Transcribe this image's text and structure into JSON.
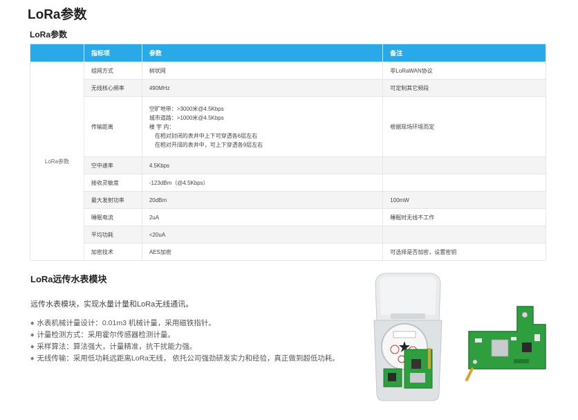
{
  "page_title": "LoRa参数",
  "section_title": "LoRa参数",
  "table": {
    "headers": [
      "",
      "指标项",
      "参数",
      "备注"
    ],
    "group_label": "LoRa参数",
    "rows": [
      {
        "item": "组网方式",
        "param": "树状网",
        "note": "非LoRaWAN协议"
      },
      {
        "item": "无线核心频率",
        "param": "490MHz",
        "note": "可定制其它频段"
      },
      {
        "item": "传输距离",
        "param_lines": [
          "空旷地带：>3000米@4.5Kbps",
          "城市道路：>1000米@4.5Kbps",
          "楼 宇 内：",
          "在相对封闭的表井中上下可穿透各6层左右",
          "在相对开阔的表井中，可上下穿透各9层左右"
        ],
        "note": "根据现场环境而定"
      },
      {
        "item": "空中速率",
        "param": "4.5Kbps",
        "note": ""
      },
      {
        "item": "接收灵敏度",
        "param": "-123dBm（@4.5Kbps）",
        "note": ""
      },
      {
        "item": "最大发射功率",
        "param": "20dBm",
        "note": "100mW"
      },
      {
        "item": "睡眠电流",
        "param": "2uA",
        "note": "睡眠时无线不工作"
      },
      {
        "item": "平均功耗",
        "param": "<20uA",
        "note": ""
      },
      {
        "item": "加密技术",
        "param": "AES加密",
        "note": "可选择是否加密，设置密钥"
      }
    ]
  },
  "module": {
    "title": "LoRa远传水表模块",
    "intro": "远传水表模块，实现水量计量和LoRa无线通讯。",
    "features": [
      "水表机械计量设计：0.01m3 机械计量，采用磁铁指针。",
      "计量检测方式：采用霍尔传感器检测计量。",
      "采样算法：算法强大，计量精准，抗干扰能力强。",
      "无线传输：采用低功耗远距离LoRa无线， 依托公司强劲研发实力和经验，真正做到超低功耗。"
    ]
  },
  "colors": {
    "header_bg": "#2aa9e8",
    "pcb_green": "#2e9e3e"
  }
}
